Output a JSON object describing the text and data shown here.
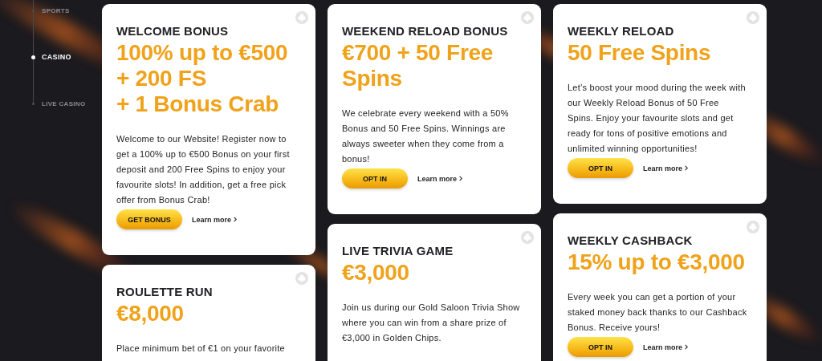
{
  "sidebar": {
    "items": [
      {
        "label": "SPORTS",
        "selected": false
      },
      {
        "label": "CASINO",
        "selected": true
      },
      {
        "label": "LIVE CASINO",
        "selected": false
      }
    ]
  },
  "columns": [
    {
      "cards": [
        {
          "title": "WELCOME BONUS",
          "amount": "100% up to €500\n+ 200 FS\n+ 1 Bonus Crab",
          "description": "Welcome to our Website! Register now to get a 100% up to €500 Bonus on your first deposit and 200 Free Spins to enjoy your favourite slots! In addition, get a free pick offer from Bonus Crab!",
          "button": "GET BONUS",
          "link": "Learn more"
        },
        {
          "title": "ROULETTE RUN",
          "amount": "€8,000",
          "description": "Place minimum bet of €1 on your favorite"
        }
      ]
    },
    {
      "cards": [
        {
          "title": "WEEKEND RELOAD BONUS",
          "amount": "€700 + 50 Free Spins",
          "description": "We celebrate every weekend with a 50% Bonus and 50 Free Spins. Winnings are always sweeter when they come from a bonus!",
          "button": "OPT IN",
          "link": "Learn more"
        },
        {
          "title": "LIVE TRIVIA GAME",
          "amount": "€3,000",
          "description": "Join us during our Gold Saloon Trivia Show where you can win from a share prize of €3,000 in Golden Chips."
        }
      ]
    },
    {
      "cards": [
        {
          "title": "WEEKLY RELOAD",
          "amount": "50 Free Spins",
          "description": "Let’s boost your mood during the week with our Weekly Reload Bonus of 50 Free Spins. Enjoy your favourite slots and get ready for tons of positive emotions and unlimited winning opportunities!",
          "button": "OPT IN",
          "link": "Learn more"
        },
        {
          "title": "WEEKLY CASHBACK",
          "amount": "15% up to €3,000",
          "description": "Every week you can get a portion of your staked money back thanks to our Cashback Bonus. Receive yours!",
          "button": "OPT IN",
          "link": "Learn more"
        }
      ]
    }
  ]
}
